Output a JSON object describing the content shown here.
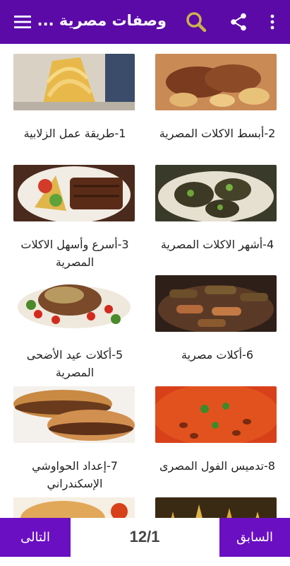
{
  "app_bar": {
    "title": "وصفات مصرية ...",
    "icons": [
      "more-vert-icon",
      "share-icon",
      "search-icon",
      "menu-icon"
    ]
  },
  "recipes": [
    {
      "label": "2-أبسط الاكلات المصرية"
    },
    {
      "label": "1-طريقة عمل الزلابية"
    },
    {
      "label": "4-أشهر الاكلات المصرية"
    },
    {
      "label": "3-أسرع وأسهل الاكلات المصرية"
    },
    {
      "label": "6-أكلات مصرية"
    },
    {
      "label": "5-أكلات عيد الأضحى المصرية"
    },
    {
      "label": "8-تدميس الفول المصرى"
    },
    {
      "label": "7-إعداد الحواوشي الإسكندراني"
    }
  ],
  "pagination": {
    "prev_label": "السابق",
    "next_label": "التالى",
    "page_indicator": "12/1"
  },
  "colors": {
    "app_bar": "#5b0aa8",
    "buttons": "#6a0fc2",
    "text": "#222222"
  }
}
